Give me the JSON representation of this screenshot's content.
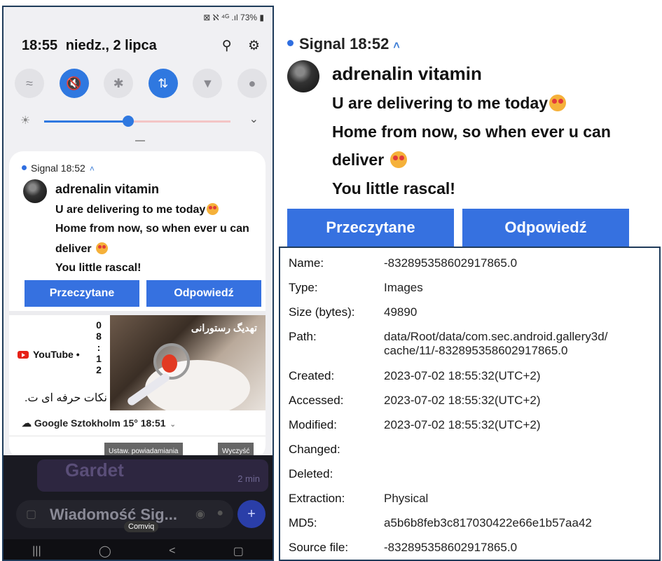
{
  "phone": {
    "status_bar": "⊠ ℵ ⁴ᴳ .ıl 73% ▮",
    "header": {
      "time": "18:55",
      "date": "niedz., 2 lipca"
    },
    "tiles": [
      "wifi-icon",
      "sound-mute-icon",
      "bluetooth-icon",
      "data-transfer-icon",
      "flashlight-icon",
      "location-icon"
    ],
    "brightness": 0.45,
    "signal": {
      "app_time": "Signal 18:52",
      "sender": "adrenalin vitamin",
      "lines": [
        "U are delivering to me today",
        "Home from now, so when ever u can",
        "deliver",
        "You little rascal!"
      ],
      "read_button": "Przeczytane",
      "reply_button": "Odpowiedź"
    },
    "youtube": {
      "label": "YouTube •",
      "time_chars": [
        "0",
        "8",
        ":",
        "1",
        "2"
      ],
      "subtitle": "نکات حرفه ای ت.",
      "thumb_text": "تهدیگ رستورانی"
    },
    "weather": {
      "text": "Google  Sztokholm 15°  18:51"
    },
    "footer": {
      "settings_button": "Ustaw. powiadamiania",
      "clear_button": "Wyczyść"
    },
    "background": {
      "chat_name": "Gardet",
      "chat_time": "2 min",
      "compose_placeholder": "Wiadomość Sig...",
      "toast": "Comviq"
    },
    "navbar": [
      "|||",
      "◯",
      "<",
      "▢"
    ]
  },
  "zoom": {
    "app_time": "Signal 18:52",
    "sender": "adrenalin vitamin",
    "lines": [
      "U are delivering to me today",
      "Home from now, so when ever u can",
      "deliver",
      "You little rascal!"
    ],
    "read_button": "Przeczytane",
    "reply_button": "Odpowiedź"
  },
  "properties": {
    "rows": [
      {
        "label": "Name:",
        "value": "-832895358602917865.0"
      },
      {
        "label": "Type:",
        "value": "Images"
      },
      {
        "label": "Size (bytes):",
        "value": "49890"
      },
      {
        "label": "Path:",
        "value": "data/Root/data/com.sec.android.gallery3d/",
        "value2": "cache/11/-832895358602917865.0"
      },
      {
        "label": "Created:",
        "value": "2023-07-02 18:55:32(UTC+2)"
      },
      {
        "label": "Accessed:",
        "value": "2023-07-02 18:55:32(UTC+2)"
      },
      {
        "label": "Modified:",
        "value": "2023-07-02 18:55:32(UTC+2)"
      },
      {
        "label": "Changed:",
        "value": ""
      },
      {
        "label": "Deleted:",
        "value": ""
      },
      {
        "label": "Extraction:",
        "value": "Physical"
      },
      {
        "label": "MD5:",
        "value": "a5b6b8feb3c817030422e66e1b57aa42"
      },
      {
        "label": "Source file:",
        "value": "-832895358602917865.0"
      }
    ]
  },
  "colors": {
    "accent": "#3671e0",
    "border": "#1f3b5a"
  }
}
